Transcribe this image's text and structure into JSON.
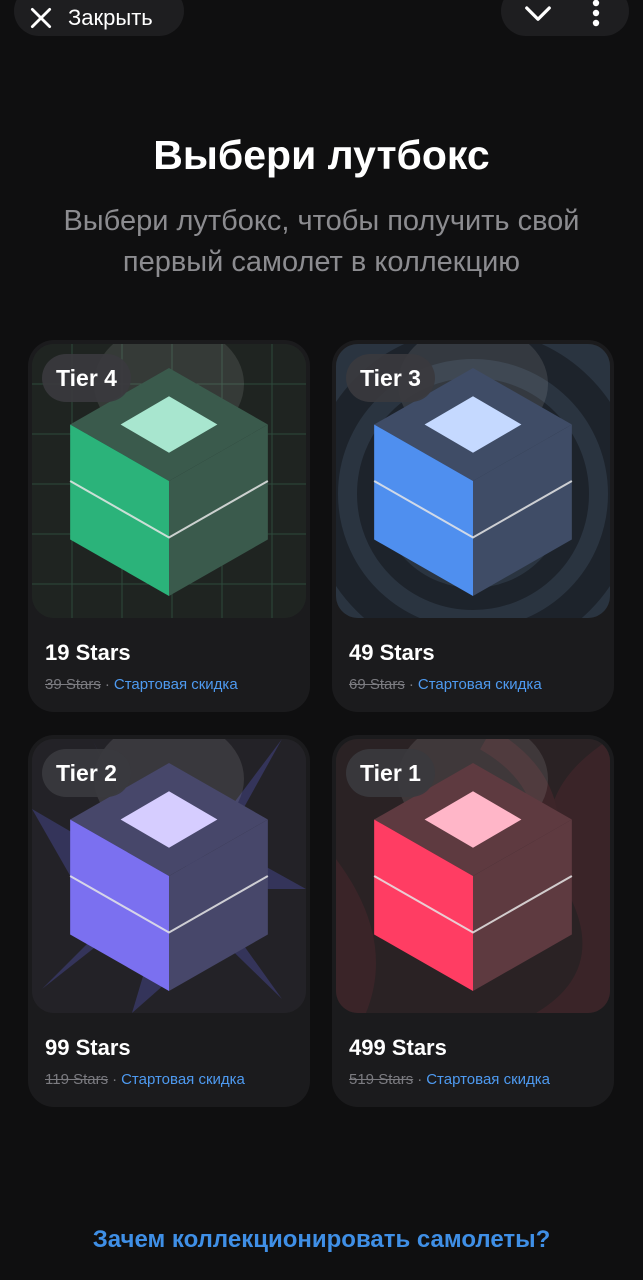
{
  "header": {
    "close_label": "Закрыть",
    "close_icon": "close-icon",
    "collapse_icon": "chevron-down-icon",
    "menu_icon": "more-vertical-icon"
  },
  "title": "Выбери лутбокс",
  "subtitle": "Выбери лутбокс, чтобы получить свой первый самолет в коллекцию",
  "lootboxes": [
    {
      "tier": "Tier 4",
      "price": "19 Stars",
      "old_price": "39 Stars",
      "separator": "·",
      "discount": "Стартовая скидка",
      "color_top": "#a8e6cf",
      "color_left": "#2bb37a",
      "color_right": "#3a5a4c",
      "background": "grid"
    },
    {
      "tier": "Tier 3",
      "price": "49 Stars",
      "old_price": "69 Stars",
      "separator": "·",
      "discount": "Стартовая скидка",
      "color_top": "#c5d9ff",
      "color_left": "#4f8fef",
      "color_right": "#3f4c66",
      "background": "swirl"
    },
    {
      "tier": "Tier 2",
      "price": "99 Stars",
      "old_price": "119 Stars",
      "separator": "·",
      "discount": "Стартовая скидка",
      "color_top": "#d6cdff",
      "color_left": "#7b70f0",
      "color_right": "#47476a",
      "background": "spikes"
    },
    {
      "tier": "Tier 1",
      "price": "499 Stars",
      "old_price": "519 Stars",
      "separator": "·",
      "discount": "Стартовая скидка",
      "color_top": "#ffb6c8",
      "color_left": "#ff3d63",
      "color_right": "#5e3a40",
      "background": "flames"
    }
  ],
  "footer_link": "Зачем коллекционировать самолеты?"
}
